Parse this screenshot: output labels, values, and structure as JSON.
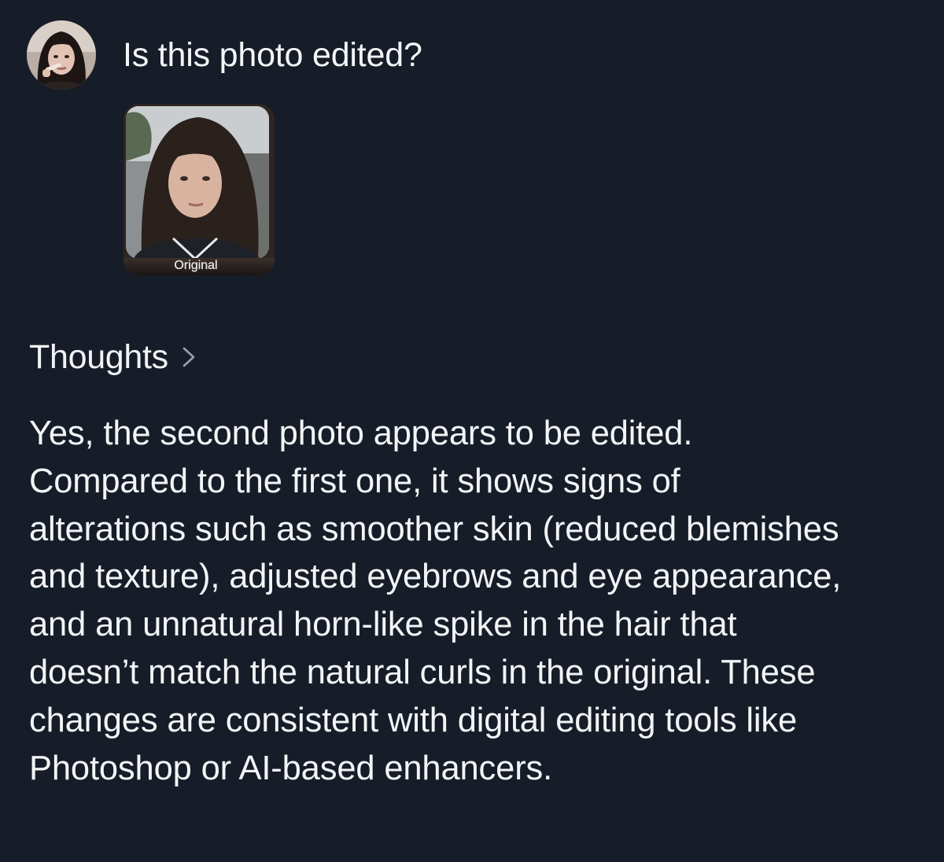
{
  "user_message": {
    "avatar_icon": "user-avatar-photo",
    "question": "Is this photo edited?",
    "attachment": {
      "label": "Original"
    }
  },
  "response": {
    "thoughts_label": "Thoughts",
    "chevron_icon": "chevron-right-icon",
    "answer_lines": [
      "Yes, the second photo appears to be edited.",
      "Compared to the first one, it shows signs of",
      "alterations such as smoother skin (reduced blemishes",
      "and texture), adjusted eyebrows and eye appearance,",
      "and an unnatural horn-like spike in the hair that",
      "doesn’t match the natural curls in the original. These",
      "changes are consistent with digital editing tools like",
      "Photoshop or AI-based enhancers."
    ]
  },
  "colors": {
    "background": "#171d28",
    "text": "#f3f4f6",
    "chevron": "#9aa0a8"
  }
}
